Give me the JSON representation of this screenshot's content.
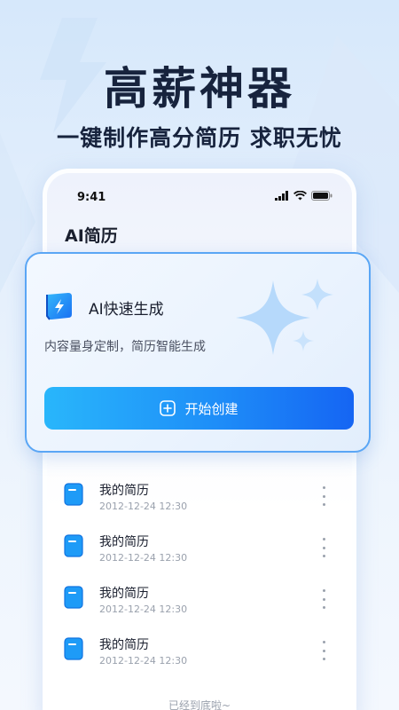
{
  "hero": {
    "headline": "高薪神器",
    "subline": "一键制作高分简历 求职无忧"
  },
  "status_bar": {
    "time": "9:41"
  },
  "app": {
    "title": "AI简历"
  },
  "ai_card": {
    "title": "AI快速生成",
    "description": "内容量身定制，简历智能生成",
    "button_label": "开始创建",
    "icon": "lightning-icon"
  },
  "resumes": [
    {
      "name": "我的简历",
      "date": "2012-12-24 12:30"
    },
    {
      "name": "我的简历",
      "date": "2012-12-24 12:30"
    },
    {
      "name": "我的简历",
      "date": "2012-12-24 12:30"
    },
    {
      "name": "我的简历",
      "date": "2012-12-24 12:30"
    }
  ],
  "footer": {
    "end_note": "已经到底啦~"
  },
  "colors": {
    "accent": "#1e8ef8",
    "headline": "#17233d",
    "card_border": "#5aa6f5"
  }
}
